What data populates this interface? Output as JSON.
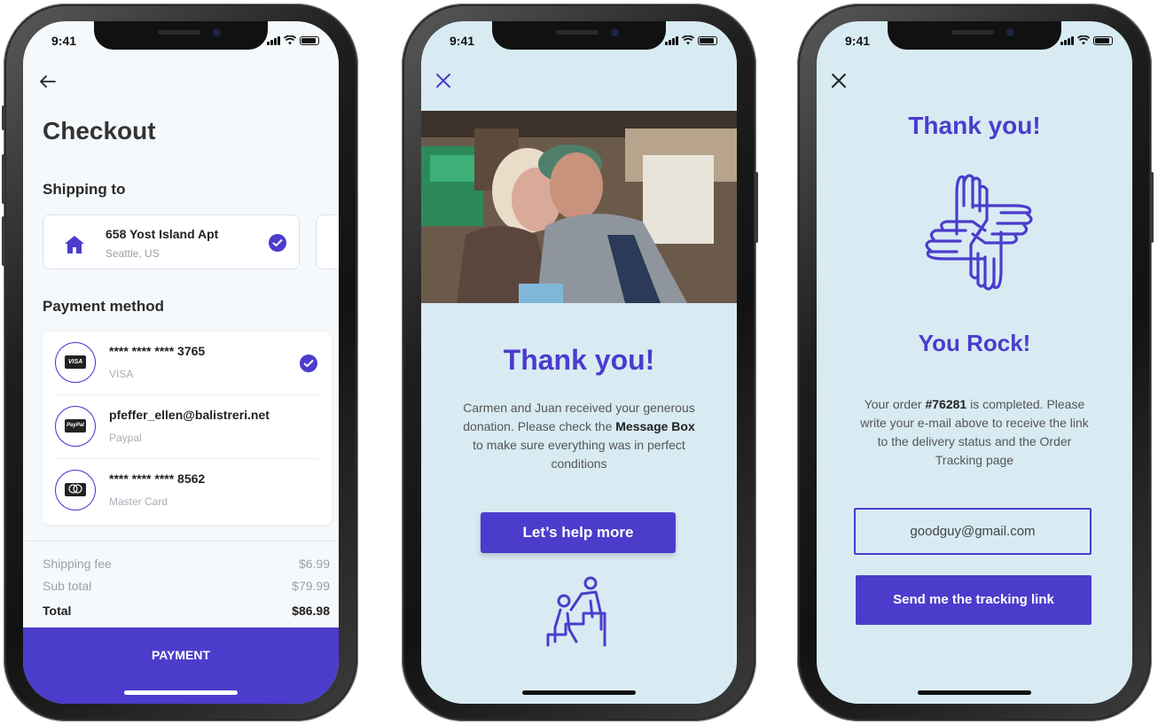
{
  "colors": {
    "accent": "#4b3ccc",
    "light_bg": "#d8ebf3"
  },
  "status_time": "9:41",
  "checkout": {
    "title": "Checkout",
    "shipping_heading": "Shipping to",
    "address": {
      "line1": "658 Yost Island Apt",
      "line2": "Seattle, US"
    },
    "payment_heading": "Payment method",
    "methods": [
      {
        "logo": "VISA",
        "primary": "**** **** **** 3765",
        "secondary": "VISA",
        "selected": true
      },
      {
        "logo": "PayPal",
        "primary": "pfeffer_ellen@balistreri.net",
        "secondary": "Paypal",
        "selected": false
      },
      {
        "logo": "mastercard-icon",
        "primary": "**** **** **** 8562",
        "secondary": "Master Card",
        "selected": false
      }
    ],
    "fees": [
      {
        "label": "Shipping fee",
        "value": "$6.99"
      },
      {
        "label": "Sub total",
        "value": "$79.99"
      },
      {
        "label": "Total",
        "value": "$86.98"
      }
    ],
    "payment_button": "PAYMENT"
  },
  "donation": {
    "title": "Thank you!",
    "text_1": "Carmen and Juan received your generous donation. Please check the",
    "text_bold": "Message Box",
    "text_2": "to make sure everything was in perfect conditions",
    "button": "Let’s help more",
    "icon": "climbing-help-icon"
  },
  "order": {
    "title": "Thank you!",
    "icon": "hands-teamwork-icon",
    "subtitle": "You Rock!",
    "text_1": "Your order",
    "order_no": "#76281",
    "text_2": "is completed. Please write your e-mail above to receive the link to the delivery status and the Order Tracking page",
    "email_value": "goodguy@gmail.com",
    "button": "Send me the tracking link"
  }
}
